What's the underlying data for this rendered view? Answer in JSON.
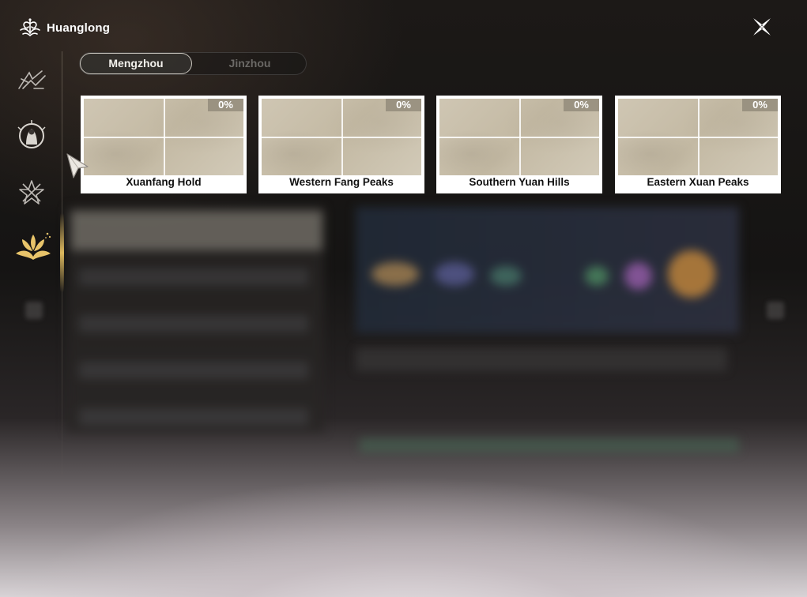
{
  "header": {
    "title": "Huanglong",
    "brand_icon": "huanglong-emblem-icon",
    "close_icon": "close-icon"
  },
  "sidebar": {
    "items": [
      {
        "name": "sidebar-item-1",
        "icon": "dragon-wing-icon",
        "active": false
      },
      {
        "name": "sidebar-item-2",
        "icon": "portrait-emblem-icon",
        "active": false
      },
      {
        "name": "sidebar-item-3",
        "icon": "star-crest-icon",
        "active": false
      },
      {
        "name": "sidebar-item-4",
        "icon": "golden-lotus-icon",
        "active": true
      }
    ]
  },
  "tabs": [
    {
      "label": "Mengzhou",
      "active": true
    },
    {
      "label": "Jinzhou",
      "active": false
    }
  ],
  "regions": [
    {
      "name": "Xuanfang Hold",
      "progress": "0%"
    },
    {
      "name": "Western Fang Peaks",
      "progress": "0%"
    },
    {
      "name": "Southern Yuan Hills",
      "progress": "0%"
    },
    {
      "name": "Eastern Xuan Peaks",
      "progress": "0%"
    }
  ],
  "colors": {
    "accent_gold": "#e8c46a",
    "card_badge": "#968e7d"
  }
}
